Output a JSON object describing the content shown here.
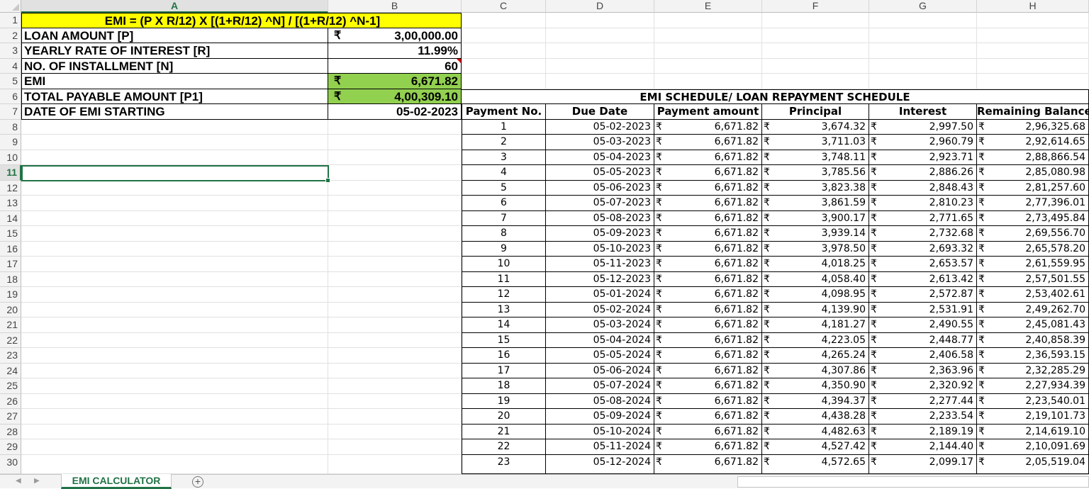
{
  "columns": [
    "A",
    "B",
    "C",
    "D",
    "E",
    "F",
    "G",
    "H"
  ],
  "rows": [
    "1",
    "2",
    "3",
    "4",
    "5",
    "6",
    "7",
    "8",
    "9",
    "10",
    "11",
    "12",
    "13",
    "14",
    "15",
    "16",
    "17",
    "18",
    "19",
    "20",
    "21",
    "22",
    "23",
    "24",
    "25",
    "26",
    "27",
    "28",
    "29",
    "30"
  ],
  "selected_row": "11",
  "selected_col": "A",
  "currency": "₹",
  "summary": {
    "formula": "EMI = (P X R/12) X [(1+R/12) ^N] / [(1+R/12) ^N-1]",
    "items": [
      {
        "label": "LOAN AMOUNT [P]",
        "value": "3,00,000.00",
        "rupee": true,
        "green": false
      },
      {
        "label": "YEARLY RATE OF INTEREST [R]",
        "value": "11.99%",
        "rupee": false,
        "green": false
      },
      {
        "label": "NO. OF INSTALLMENT [N]",
        "value": "60",
        "rupee": false,
        "green": false
      },
      {
        "label": "EMI",
        "value": "6,671.82",
        "rupee": true,
        "green": true
      },
      {
        "label": "TOTAL PAYABLE AMOUNT [P1]",
        "value": "4,00,309.10",
        "rupee": true,
        "green": true
      },
      {
        "label": "DATE OF EMI STARTING",
        "value": "05-02-2023",
        "rupee": false,
        "green": false
      }
    ]
  },
  "schedule": {
    "title": "EMI SCHEDULE/ LOAN REPAYMENT SCHEDULE",
    "headers": [
      "Payment No.",
      "Due Date",
      "Payment amount",
      "Principal",
      "Interest",
      "Remaining Balance"
    ],
    "rows": [
      [
        "1",
        "05-02-2023",
        "6,671.82",
        "3,674.32",
        "2,997.50",
        "2,96,325.68"
      ],
      [
        "2",
        "05-03-2023",
        "6,671.82",
        "3,711.03",
        "2,960.79",
        "2,92,614.65"
      ],
      [
        "3",
        "05-04-2023",
        "6,671.82",
        "3,748.11",
        "2,923.71",
        "2,88,866.54"
      ],
      [
        "4",
        "05-05-2023",
        "6,671.82",
        "3,785.56",
        "2,886.26",
        "2,85,080.98"
      ],
      [
        "5",
        "05-06-2023",
        "6,671.82",
        "3,823.38",
        "2,848.43",
        "2,81,257.60"
      ],
      [
        "6",
        "05-07-2023",
        "6,671.82",
        "3,861.59",
        "2,810.23",
        "2,77,396.01"
      ],
      [
        "7",
        "05-08-2023",
        "6,671.82",
        "3,900.17",
        "2,771.65",
        "2,73,495.84"
      ],
      [
        "8",
        "05-09-2023",
        "6,671.82",
        "3,939.14",
        "2,732.68",
        "2,69,556.70"
      ],
      [
        "9",
        "05-10-2023",
        "6,671.82",
        "3,978.50",
        "2,693.32",
        "2,65,578.20"
      ],
      [
        "10",
        "05-11-2023",
        "6,671.82",
        "4,018.25",
        "2,653.57",
        "2,61,559.95"
      ],
      [
        "11",
        "05-12-2023",
        "6,671.82",
        "4,058.40",
        "2,613.42",
        "2,57,501.55"
      ],
      [
        "12",
        "05-01-2024",
        "6,671.82",
        "4,098.95",
        "2,572.87",
        "2,53,402.61"
      ],
      [
        "13",
        "05-02-2024",
        "6,671.82",
        "4,139.90",
        "2,531.91",
        "2,49,262.70"
      ],
      [
        "14",
        "05-03-2024",
        "6,671.82",
        "4,181.27",
        "2,490.55",
        "2,45,081.43"
      ],
      [
        "15",
        "05-04-2024",
        "6,671.82",
        "4,223.05",
        "2,448.77",
        "2,40,858.39"
      ],
      [
        "16",
        "05-05-2024",
        "6,671.82",
        "4,265.24",
        "2,406.58",
        "2,36,593.15"
      ],
      [
        "17",
        "05-06-2024",
        "6,671.82",
        "4,307.86",
        "2,363.96",
        "2,32,285.29"
      ],
      [
        "18",
        "05-07-2024",
        "6,671.82",
        "4,350.90",
        "2,320.92",
        "2,27,934.39"
      ],
      [
        "19",
        "05-08-2024",
        "6,671.82",
        "4,394.37",
        "2,277.44",
        "2,23,540.01"
      ],
      [
        "20",
        "05-09-2024",
        "6,671.82",
        "4,438.28",
        "2,233.54",
        "2,19,101.73"
      ],
      [
        "21",
        "05-10-2024",
        "6,671.82",
        "4,482.63",
        "2,189.19",
        "2,14,619.10"
      ],
      [
        "22",
        "05-11-2024",
        "6,671.82",
        "4,527.42",
        "2,144.40",
        "2,10,091.69"
      ],
      [
        "23",
        "05-12-2024",
        "6,671.82",
        "4,572.65",
        "2,099.17",
        "2,05,519.04"
      ]
    ]
  },
  "sheet_tabs": {
    "active": "EMI CALCULATOR",
    "add_label": "+",
    "prev_arrow": "◀",
    "next_arrow": "▶"
  },
  "colors": {
    "formula_bg": "#ffff00",
    "green_bg": "#92d050",
    "selection": "#217346"
  }
}
